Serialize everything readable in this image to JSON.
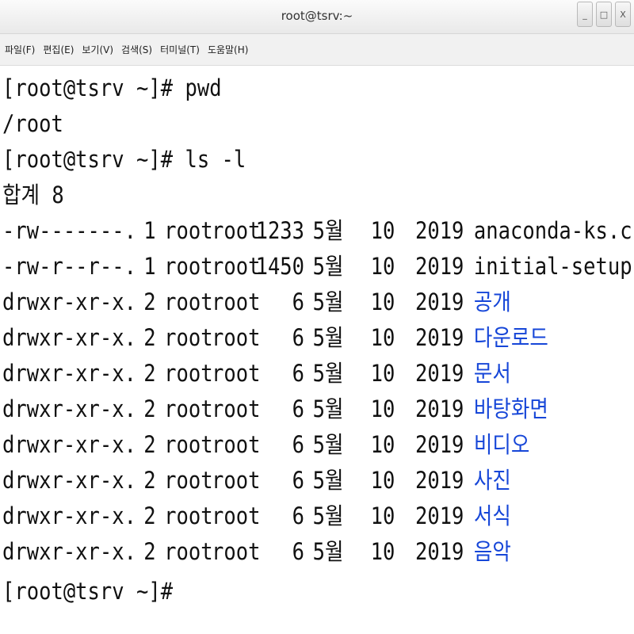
{
  "window": {
    "title": "root@tsrv:~",
    "buttons": [
      "_",
      "□",
      "X"
    ]
  },
  "menu": [
    "파일(F)",
    "편집(E)",
    "보기(V)",
    "검색(S)",
    "터미널(T)",
    "도움말(H)"
  ],
  "terminal": {
    "prompt_lines": [
      "[root@tsrv ~]# pwd",
      "/root",
      "[root@tsrv ~]# ls -l",
      "합계 8"
    ],
    "listing": [
      {
        "perms": "-rw-------.",
        "links": "1",
        "owner": "root",
        "group": "root",
        "size": "1233",
        "month": "5월",
        "day": "10",
        "year": "2019",
        "name": "anaconda-ks.cfg",
        "kind": "file"
      },
      {
        "perms": "-rw-r--r--.",
        "links": "1",
        "owner": "root",
        "group": "root",
        "size": "1450",
        "month": "5월",
        "day": "10",
        "year": "2019",
        "name": "initial-setup-ks.cfg",
        "kind": "file"
      },
      {
        "perms": "drwxr-xr-x.",
        "links": "2",
        "owner": "root",
        "group": "root",
        "size": "6",
        "month": "5월",
        "day": "10",
        "year": "2019",
        "name": "공개",
        "kind": "dir"
      },
      {
        "perms": "drwxr-xr-x.",
        "links": "2",
        "owner": "root",
        "group": "root",
        "size": "6",
        "month": "5월",
        "day": "10",
        "year": "2019",
        "name": "다운로드",
        "kind": "dir"
      },
      {
        "perms": "drwxr-xr-x.",
        "links": "2",
        "owner": "root",
        "group": "root",
        "size": "6",
        "month": "5월",
        "day": "10",
        "year": "2019",
        "name": "문서",
        "kind": "dir"
      },
      {
        "perms": "drwxr-xr-x.",
        "links": "2",
        "owner": "root",
        "group": "root",
        "size": "6",
        "month": "5월",
        "day": "10",
        "year": "2019",
        "name": "바탕화면",
        "kind": "dir"
      },
      {
        "perms": "drwxr-xr-x.",
        "links": "2",
        "owner": "root",
        "group": "root",
        "size": "6",
        "month": "5월",
        "day": "10",
        "year": "2019",
        "name": "비디오",
        "kind": "dir"
      },
      {
        "perms": "drwxr-xr-x.",
        "links": "2",
        "owner": "root",
        "group": "root",
        "size": "6",
        "month": "5월",
        "day": "10",
        "year": "2019",
        "name": "사진",
        "kind": "dir"
      },
      {
        "perms": "drwxr-xr-x.",
        "links": "2",
        "owner": "root",
        "group": "root",
        "size": "6",
        "month": "5월",
        "day": "10",
        "year": "2019",
        "name": "서식",
        "kind": "dir"
      },
      {
        "perms": "drwxr-xr-x.",
        "links": "2",
        "owner": "root",
        "group": "root",
        "size": "6",
        "month": "5월",
        "day": "10",
        "year": "2019",
        "name": "음악",
        "kind": "dir"
      }
    ],
    "final_prompt": "[root@tsrv ~]#",
    "colors": {
      "text": "#111111",
      "directory": "#1646d8",
      "background": "#ffffff"
    }
  }
}
